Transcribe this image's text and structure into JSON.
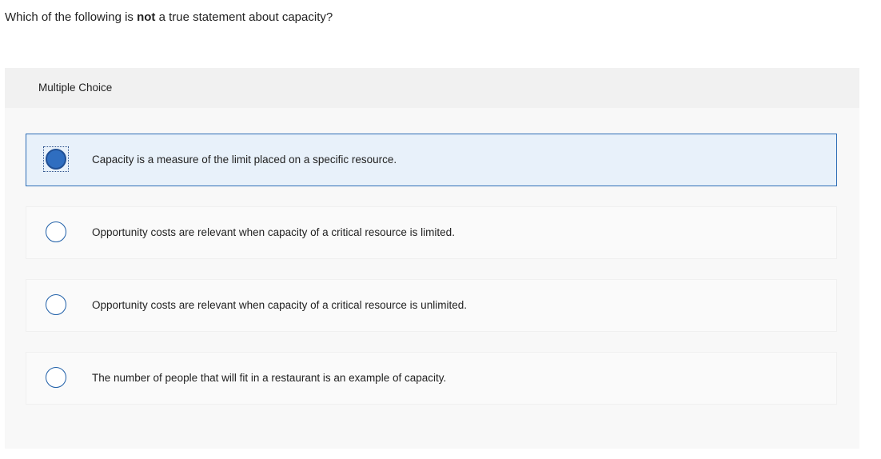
{
  "question": {
    "prefix": "Which of the following is ",
    "emphasis": "not",
    "suffix": " a true statement about capacity?"
  },
  "panel": {
    "header_label": "Multiple Choice"
  },
  "options": [
    {
      "text": "Capacity is a measure of the limit placed on a specific resource.",
      "selected": true
    },
    {
      "text": "Opportunity costs are relevant when capacity of a critical resource is limited.",
      "selected": false
    },
    {
      "text": "Opportunity costs are relevant when capacity of a critical resource is unlimited.",
      "selected": false
    },
    {
      "text": "The number of people that will fit in a restaurant is an example of capacity.",
      "selected": false
    }
  ],
  "colors": {
    "accent": "#2d6db5",
    "selected_background": "#e8f1fa",
    "panel_background": "#f8f8f8",
    "header_background": "#f1f1f1"
  }
}
